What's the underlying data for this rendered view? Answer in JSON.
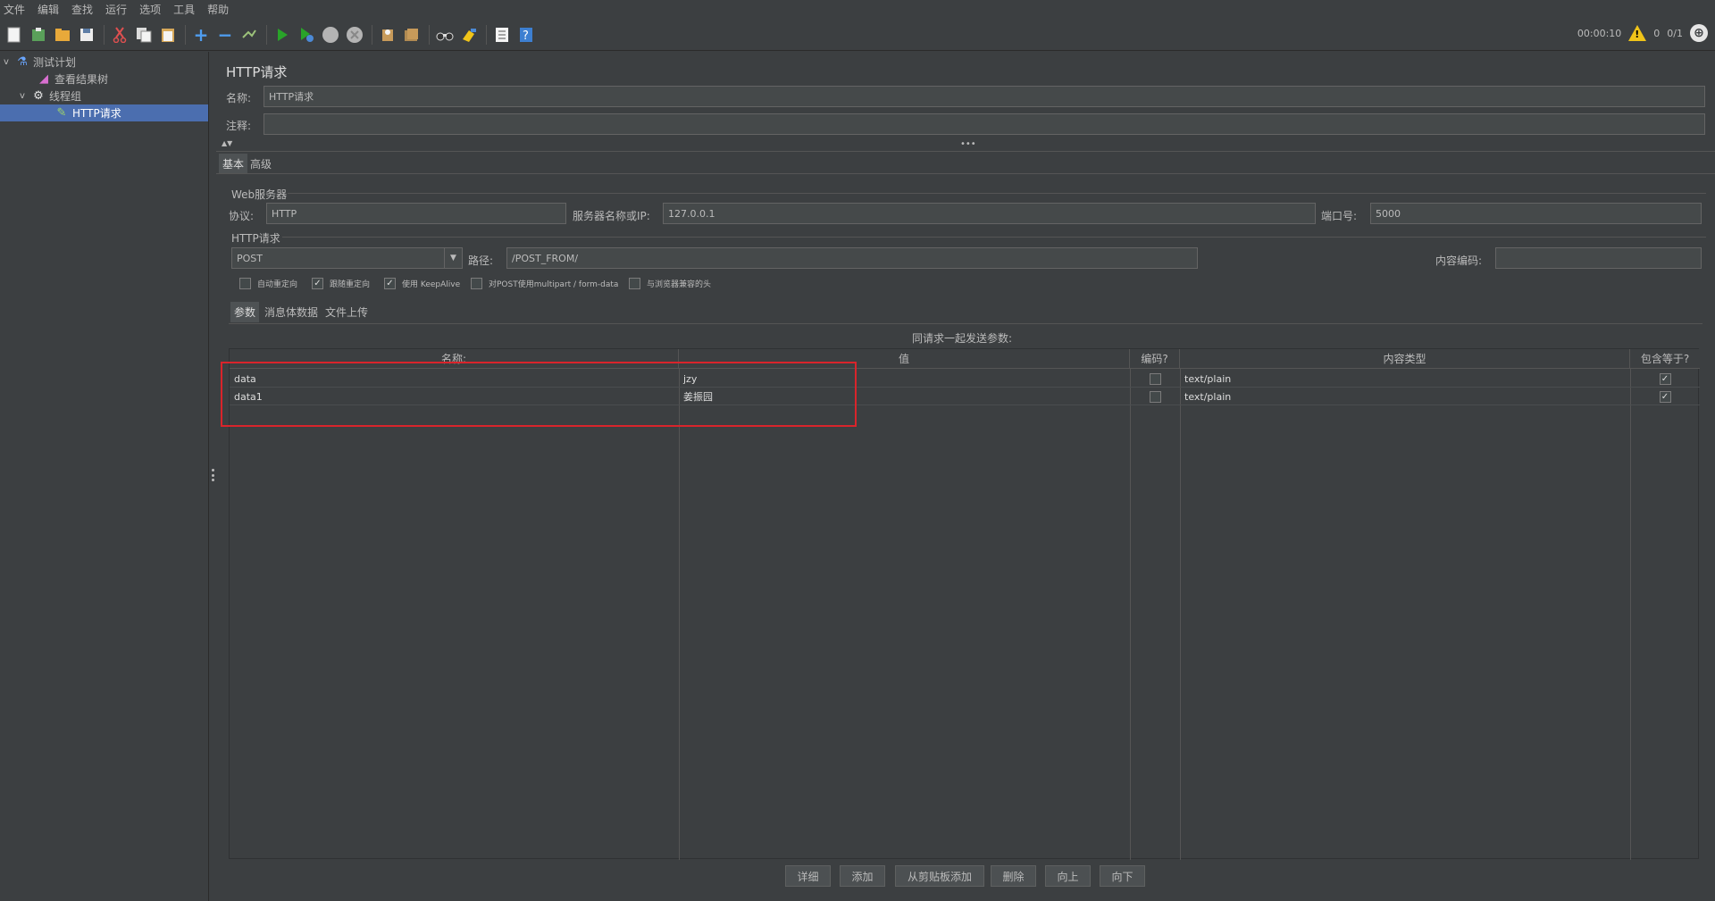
{
  "menubar": [
    "文件",
    "编辑",
    "查找",
    "运行",
    "选项",
    "工具",
    "帮助"
  ],
  "toolbar": {
    "icons": [
      "new-icon",
      "templates-icon",
      "open-icon",
      "save-icon",
      "cut-icon",
      "copy-icon",
      "paste-icon",
      "expand-icon",
      "collapse-icon",
      "toggle-icon",
      "start-icon",
      "start-no-pause-icon",
      "stop-icon",
      "shutdown-icon",
      "clear-icon",
      "clear-all-icon",
      "search-icon",
      "reset-search-icon",
      "function-helper-icon",
      "help-icon"
    ],
    "timer": "00:00:10",
    "warnings": "0",
    "threads": "0/1"
  },
  "tree": {
    "items": [
      {
        "label": "测试计划",
        "icon": "flask-icon",
        "toggle": "v"
      },
      {
        "label": "查看结果树",
        "icon": "chart-icon",
        "toggle": ""
      },
      {
        "label": "线程组",
        "icon": "gear-icon",
        "toggle": "v"
      },
      {
        "label": "HTTP请求",
        "icon": "pipette-icon",
        "toggle": ""
      }
    ]
  },
  "panel": {
    "title": "HTTP请求",
    "name_label": "名称:",
    "name_value": "HTTP请求",
    "comment_label": "注释:",
    "comment_value": "",
    "tabs": [
      "基本",
      "高级"
    ],
    "web_server_group": "Web服务器",
    "protocol_label": "协议:",
    "protocol_value": "HTTP",
    "server_label": "服务器名称或IP:",
    "server_value": "127.0.0.1",
    "port_label": "端口号:",
    "port_value": "5000",
    "http_request_group": "HTTP请求",
    "method_value": "POST",
    "path_label": "路径:",
    "path_value": "/POST_FROM/",
    "encoding_label": "内容编码:",
    "encoding_value": "",
    "checkboxes": [
      {
        "label": "自动重定向",
        "checked": false
      },
      {
        "label": "跟随重定向",
        "checked": true
      },
      {
        "label": "使用 KeepAlive",
        "checked": true
      },
      {
        "label": "对POST使用multipart / form-data",
        "checked": false
      },
      {
        "label": "与浏览器兼容的头",
        "checked": false
      }
    ],
    "subtabs": [
      "参数",
      "消息体数据",
      "文件上传"
    ],
    "params_caption": "同请求一起发送参数:",
    "table": {
      "headers": [
        "名称:",
        "值",
        "编码?",
        "内容类型",
        "包含等于?"
      ],
      "rows": [
        {
          "name": "data",
          "value": "jzy",
          "encode": false,
          "content_type": "text/plain",
          "include_equals": true
        },
        {
          "name": "data1",
          "value": "姜振园",
          "encode": false,
          "content_type": "text/plain",
          "include_equals": true
        }
      ]
    },
    "buttons": [
      "详细",
      "添加",
      "从剪贴板添加",
      "删除",
      "向上",
      "向下"
    ]
  }
}
